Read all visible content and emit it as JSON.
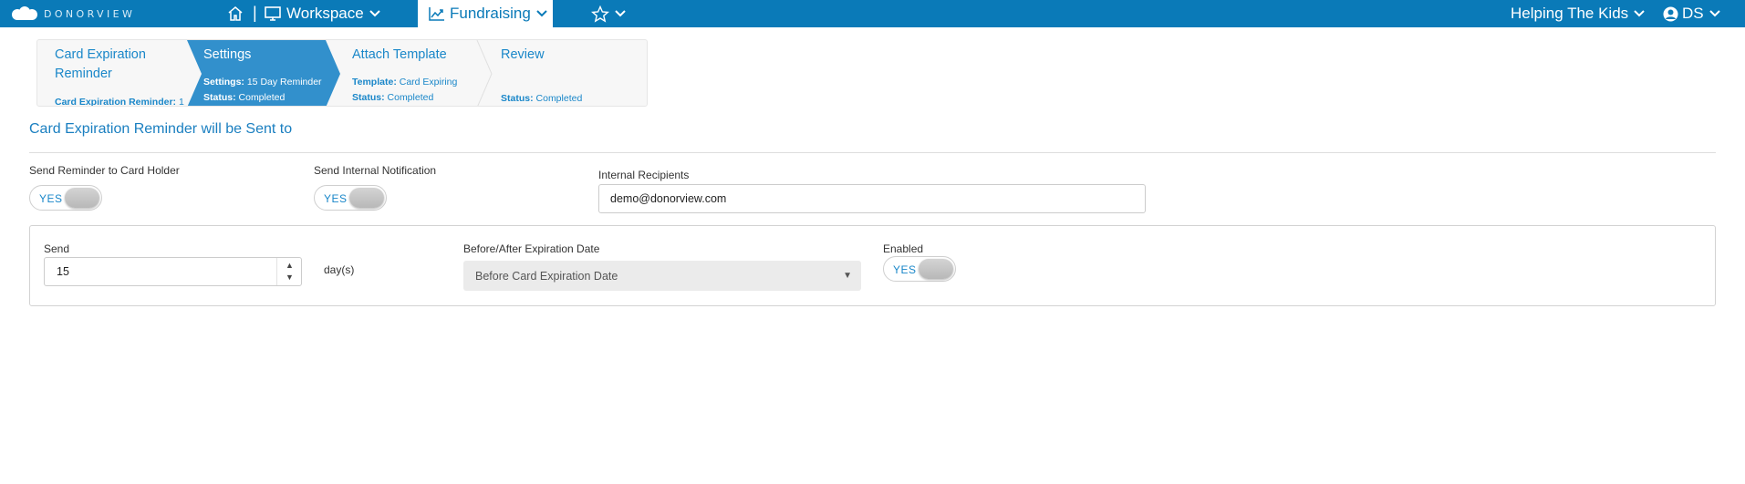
{
  "app": {
    "brand": "DONORVIEW",
    "brand_color": "#0a7ab8",
    "nav": {
      "home_icon": "home-icon",
      "separator": "|",
      "workspace_label": "Workspace",
      "fundraising_label": "Fundraising",
      "favorites_icon": "star-icon",
      "org_label": "Helping The Kids",
      "user_initials": "DS"
    }
  },
  "wizard": {
    "steps": [
      {
        "title": "Card Expiration Reminder",
        "meta1_key": "Card Expiration Reminder:",
        "meta1_value": "1"
      },
      {
        "title": "Settings",
        "meta1_key": "Settings:",
        "meta1_value": "15 Day Reminder",
        "meta2_key": "Status:",
        "meta2_value": "Completed",
        "active": true
      },
      {
        "title": "Attach Template",
        "meta1_key": "Template:",
        "meta1_value": "Card Expiring",
        "meta2_key": "Status:",
        "meta2_value": "Completed"
      },
      {
        "title": "Review",
        "meta2_key": "Status:",
        "meta2_value": "Completed"
      }
    ]
  },
  "section": {
    "title": "Card Expiration Reminder will be Sent to"
  },
  "recipients": {
    "card_holder_label": "Send Reminder to Card Holder",
    "card_holder_toggle": "YES",
    "internal_label": "Send Internal Notification",
    "internal_toggle": "YES",
    "internal_recipients_label": "Internal Recipients",
    "internal_recipients_value": "demo@donorview.com"
  },
  "rule": {
    "send_label": "Send",
    "send_value": "15",
    "days_label": "day(s)",
    "timing_label": "Before/After Expiration Date",
    "timing_value": "Before Card Expiration Date",
    "enabled_label": "Enabled",
    "enabled_toggle": "YES"
  }
}
